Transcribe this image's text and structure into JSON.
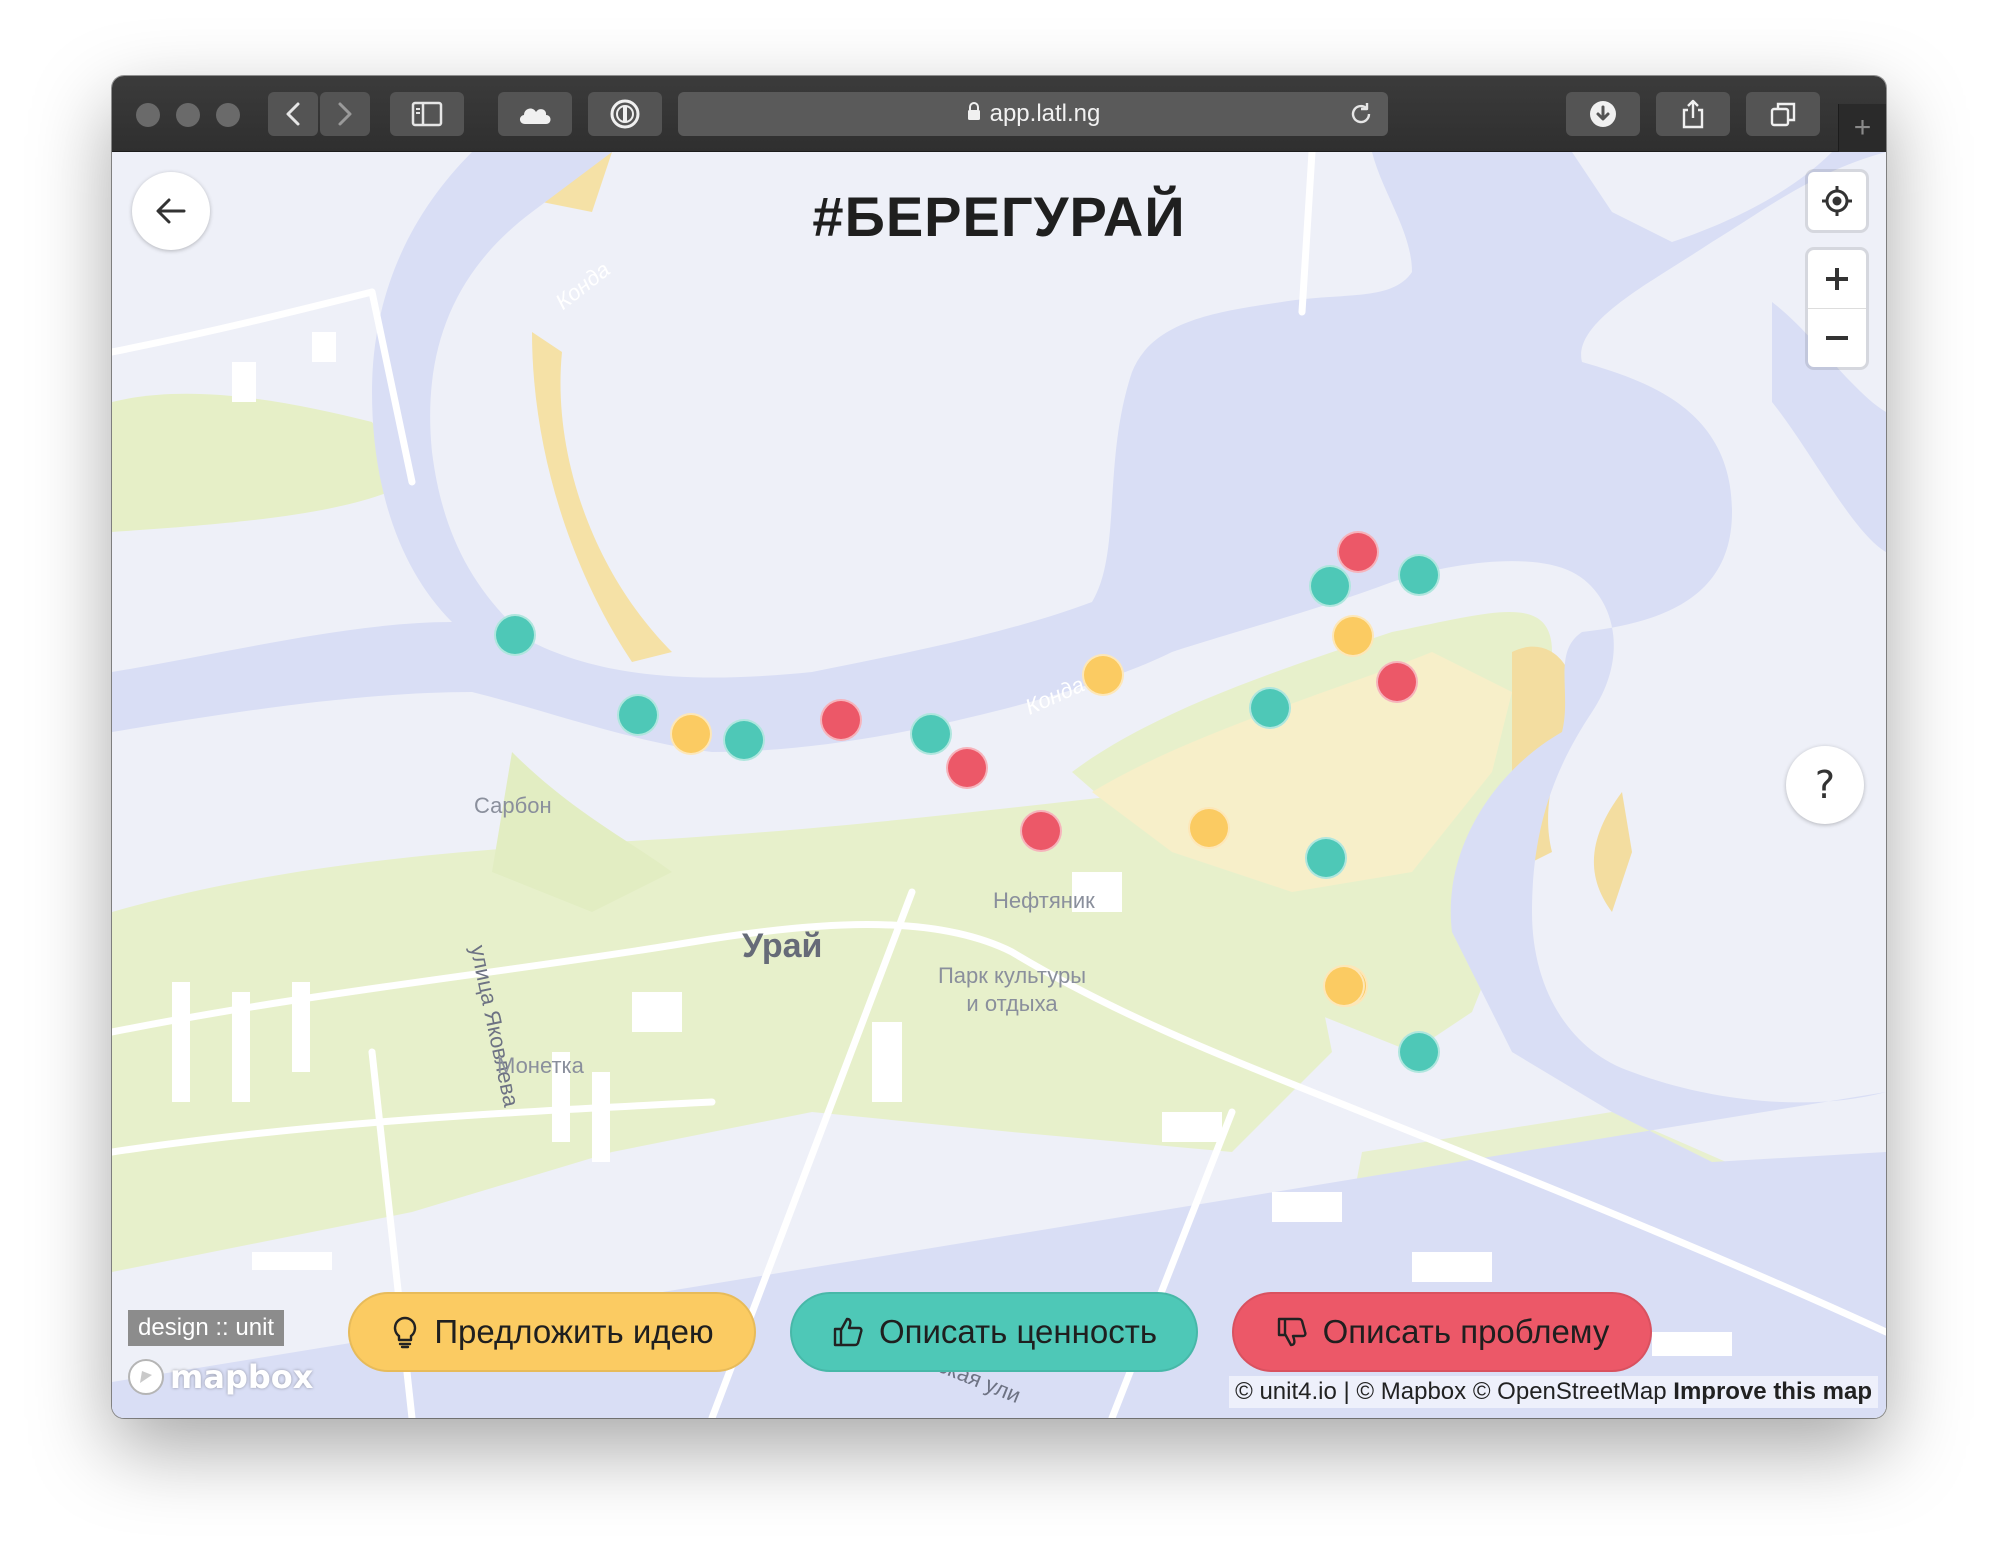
{
  "browser": {
    "url": "app.latl.ng",
    "new_tab_label": "+"
  },
  "page": {
    "title": "#БЕРЕГУРАЙ",
    "help_label": "?"
  },
  "map": {
    "labels": {
      "river_1": "Конда",
      "river_2": "Конда",
      "restaurant": "Сарбон",
      "stadium": "Нефтяник",
      "city": "Урай",
      "park": "Парк культуры\nи отдыха",
      "park_line1": "Парк культуры",
      "park_line2": "и отдыха",
      "street": "улица Яковлева",
      "shop": "Монетка",
      "street_bottom": "анская ули"
    },
    "markers": [
      {
        "kind": "value",
        "color": "#4ec8b7"
      },
      {
        "kind": "value",
        "color": "#4ec8b7"
      },
      {
        "kind": "idea",
        "color": "#fbcb62"
      },
      {
        "kind": "value",
        "color": "#4ec8b7"
      },
      {
        "kind": "problem",
        "color": "#ec5868"
      },
      {
        "kind": "value",
        "color": "#4ec8b7"
      },
      {
        "kind": "problem",
        "color": "#ec5868"
      },
      {
        "kind": "problem",
        "color": "#ec5868"
      },
      {
        "kind": "idea",
        "color": "#fbcb62"
      },
      {
        "kind": "value",
        "color": "#4ec8b7"
      },
      {
        "kind": "idea",
        "color": "#fbcb62"
      },
      {
        "kind": "problem",
        "color": "#ec5868"
      },
      {
        "kind": "value",
        "color": "#4ec8b7"
      },
      {
        "kind": "problem",
        "color": "#ec5868"
      },
      {
        "kind": "value",
        "color": "#4ec8b7"
      },
      {
        "kind": "idea",
        "color": "#fbcb62"
      },
      {
        "kind": "idea",
        "color": "#fbcb62"
      },
      {
        "kind": "value",
        "color": "#4ec8b7"
      },
      {
        "kind": "idea",
        "color": "#fbcb62"
      },
      {
        "kind": "value",
        "color": "#4ec8b7"
      }
    ]
  },
  "actions": {
    "idea_label": "Предложить идею",
    "value_label": "Описать ценность",
    "problem_label": "Описать проблему",
    "idea_color": "#fbcb62",
    "value_color": "#4ec8b7",
    "problem_color": "#ec5868"
  },
  "branding": {
    "design_unit": "design :: unit",
    "mapbox": "mapbox"
  },
  "attribution": {
    "text": "© unit4.io | © Mapbox © OpenStreetMap",
    "improve": "Improve this map"
  }
}
